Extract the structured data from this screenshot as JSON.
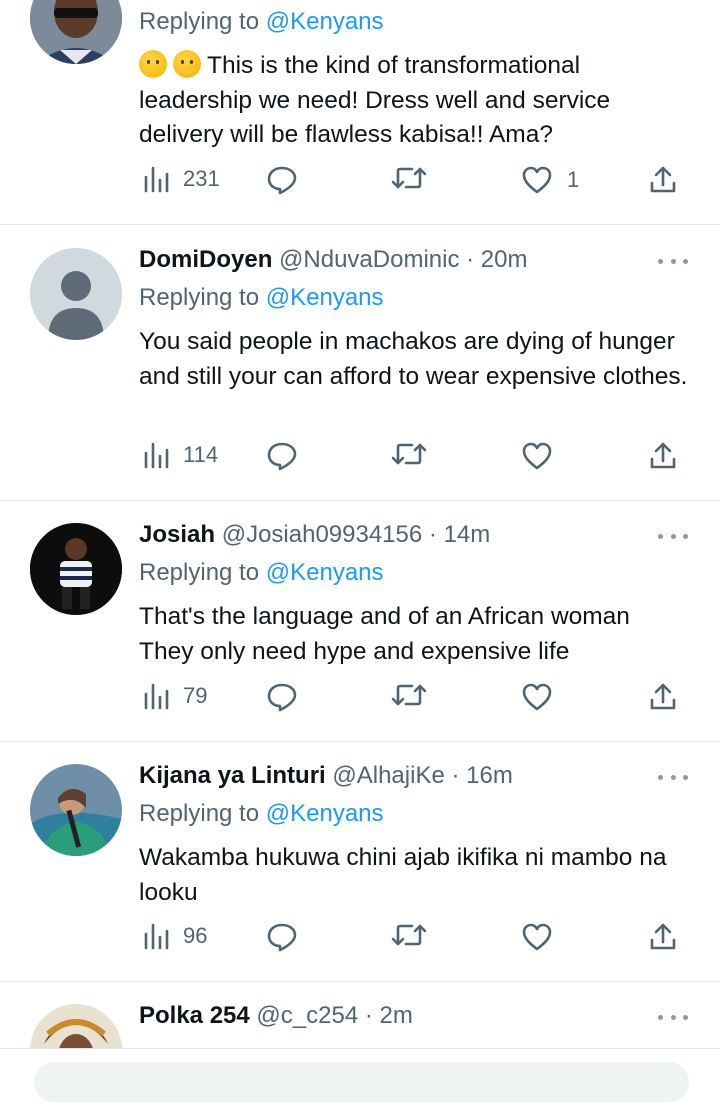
{
  "tweets": [
    {
      "name": "",
      "handle": "",
      "time": "",
      "replying_label": "Replying to",
      "replying_to": "@Kenyans",
      "text": "This is the kind of transformational leadership we need! Dress well and service delivery will be flawless kabisa!! Ama?",
      "views": "231",
      "likes": "1",
      "emoji": "thinking-face-emoji"
    },
    {
      "name": "DomiDoyen",
      "handle": "@NduvaDominic",
      "time": "20m",
      "replying_label": "Replying to",
      "replying_to": "@Kenyans",
      "text": "You said people in machakos are dying of hunger and still your can afford to wear expensive clothes.",
      "views": "114",
      "likes": ""
    },
    {
      "name": "Josiah",
      "handle": "@Josiah09934156",
      "time": "14m",
      "replying_label": "Replying to",
      "replying_to": "@Kenyans",
      "text": "That's the language and of an African woman They only need hype and expensive life",
      "views": "79",
      "likes": ""
    },
    {
      "name": "Kijana ya Linturi",
      "handle": "@AlhajiKe",
      "time": "16m",
      "replying_label": "Replying to",
      "replying_to": "@Kenyans",
      "text": "Wakamba hukuwa chini ajab ikifika ni mambo na looku",
      "views": "96",
      "likes": ""
    },
    {
      "name": "Polka 254",
      "handle": "@c_c254",
      "time": "2m"
    }
  ],
  "separator": "·",
  "icons": {
    "views": "views-icon",
    "reply": "reply-icon",
    "retweet": "retweet-icon",
    "like": "heart-icon",
    "share": "share-icon",
    "more": "more-icon"
  },
  "colors": {
    "accent": "#1d9bf0",
    "secondary_text": "#536471",
    "primary_text": "#0f1419"
  }
}
